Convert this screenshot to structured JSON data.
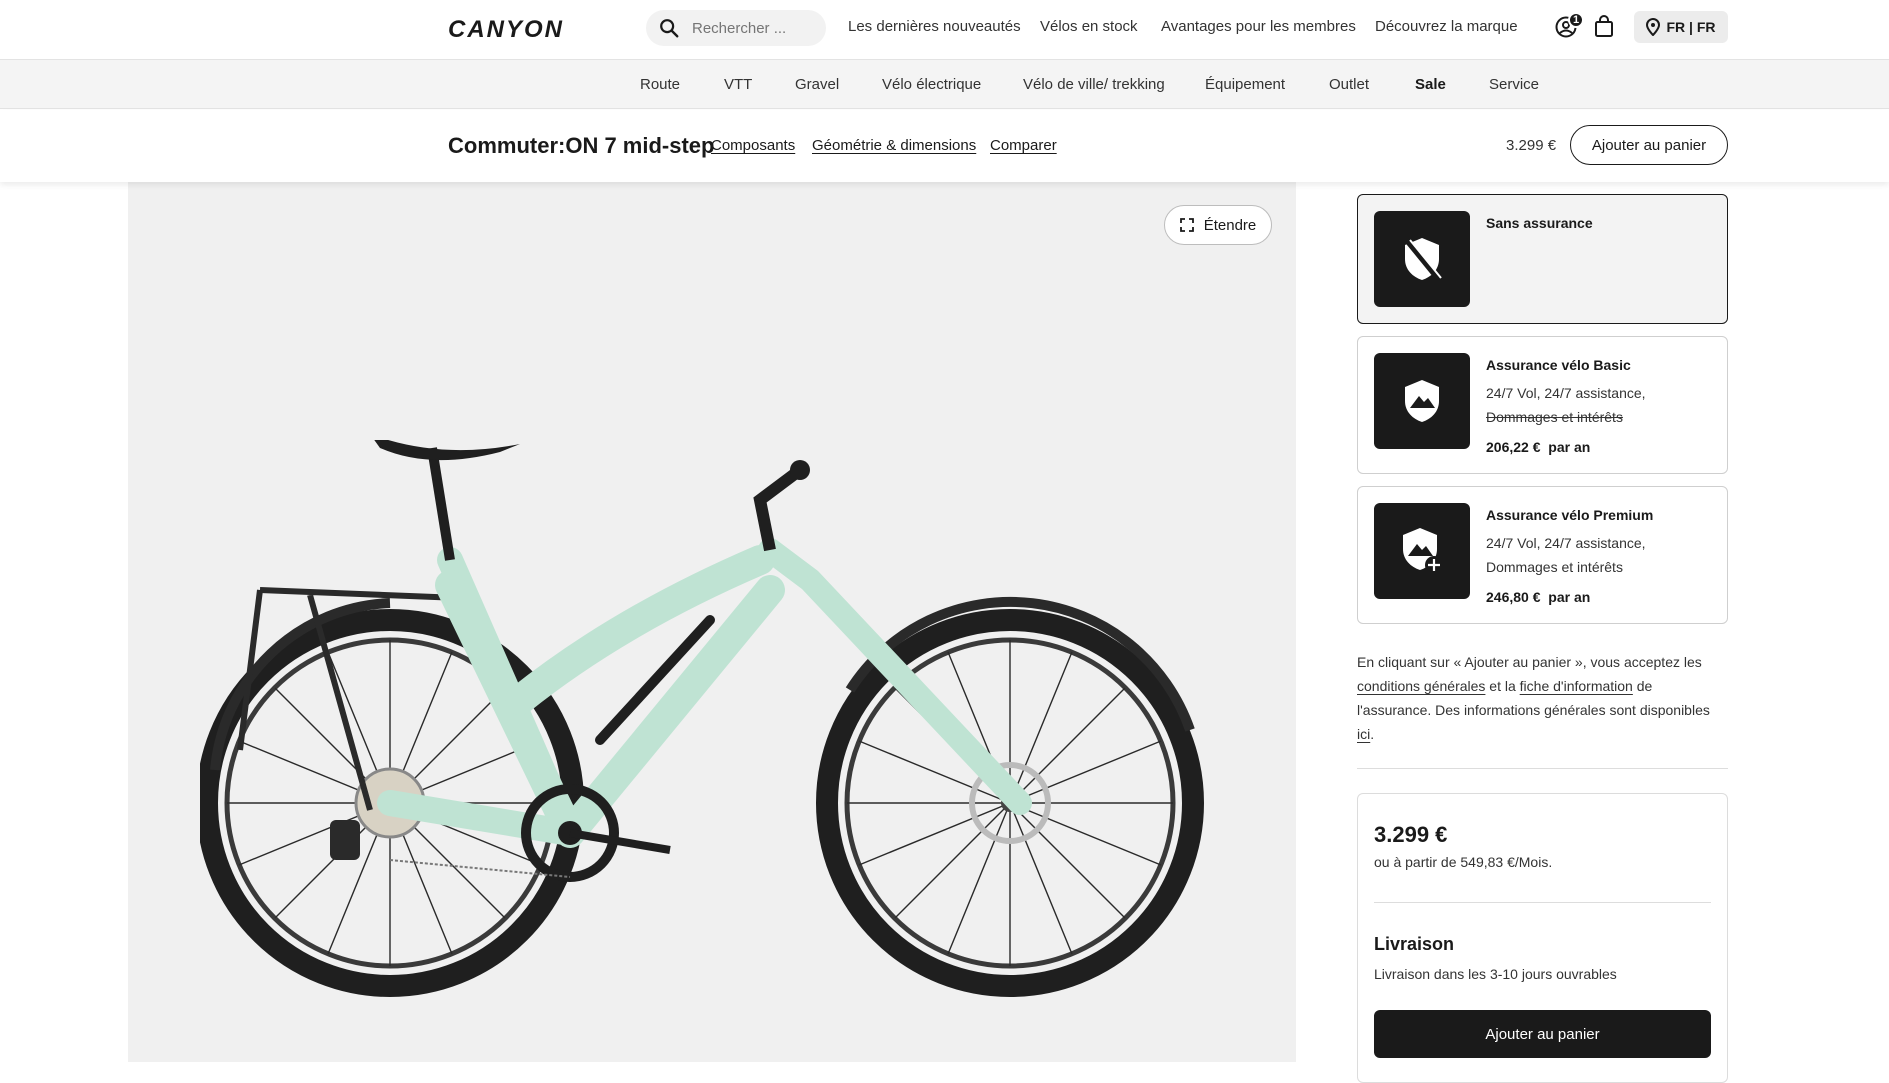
{
  "header": {
    "logo_text": "CANYON",
    "search_placeholder": "Rechercher ...",
    "nav": [
      "Les dernières nouveautés",
      "Vélos en stock",
      "Avantages pour les membres",
      "Découvrez la marque"
    ],
    "account_badge": "1",
    "locale": "FR | FR"
  },
  "categories": [
    "Route",
    "VTT",
    "Gravel",
    "Vélo électrique",
    "Vélo de ville/ trekking",
    "Équipement",
    "Outlet",
    "Sale",
    "Service"
  ],
  "product_bar": {
    "title": "Commuter:ON 7 mid-step",
    "links": [
      "Composants",
      "Géométrie & dimensions",
      "Comparer"
    ],
    "price": "3.299 €",
    "cart_button": "Ajouter au panier"
  },
  "gallery": {
    "expand_label": "Étendre",
    "frame_color": "#bfe3d3"
  },
  "insurance": [
    {
      "title": "Sans assurance",
      "selected": true,
      "icon": "shield-off-icon"
    },
    {
      "title": "Assurance vélo Basic",
      "line1": "24/7 Vol, 24/7 assistance,",
      "line2_struck": "Dommages et intérêts",
      "price": "206,22 €",
      "per": "par an",
      "icon": "shield-mountain-icon"
    },
    {
      "title": "Assurance vélo Premium",
      "line1": "24/7 Vol, 24/7 assistance,",
      "line2": "Dommages et intérêts",
      "price": "246,80 €",
      "per": "par an",
      "icon": "shield-mountain-plus-icon"
    }
  ],
  "terms": {
    "t1": "En cliquant sur « Ajouter au panier », vous acceptez les",
    "link1": "conditions générales",
    "t2": " et la ",
    "link2": "fiche d'information",
    "t3": " de l'assurance. Des informations générales sont disponibles",
    "link3": "ici",
    "t4": "."
  },
  "purchase": {
    "price": "3.299 €",
    "financing": "ou à partir de 549,83 €/Mois.",
    "delivery_title": "Livraison",
    "delivery_text": "Livraison dans les 3-10 jours ouvrables",
    "cart_button": "Ajouter au panier"
  }
}
